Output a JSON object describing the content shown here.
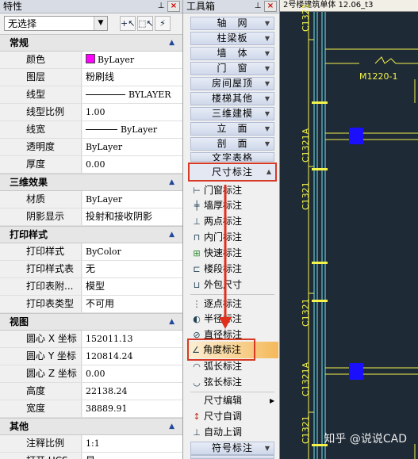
{
  "properties": {
    "title": "特性",
    "selection": "无选择",
    "sections": [
      {
        "title": "常规",
        "rows": [
          {
            "key": "颜色",
            "value": "ByLayer"
          },
          {
            "key": "图层",
            "value": "粉刷线"
          },
          {
            "key": "线型",
            "value": "BYLAYER"
          },
          {
            "key": "线型比例",
            "value": "1.00"
          },
          {
            "key": "线宽",
            "value": "ByLayer"
          },
          {
            "key": "透明度",
            "value": "ByLayer"
          },
          {
            "key": "厚度",
            "value": "0.00"
          }
        ]
      },
      {
        "title": "三维效果",
        "rows": [
          {
            "key": "材质",
            "value": "ByLayer"
          },
          {
            "key": "阴影显示",
            "value": "投射和接收阴影"
          }
        ]
      },
      {
        "title": "打印样式",
        "rows": [
          {
            "key": "打印样式",
            "value": "ByColor"
          },
          {
            "key": "打印样式表",
            "value": "无"
          },
          {
            "key": "打印表附...",
            "value": "模型"
          },
          {
            "key": "打印表类型",
            "value": "不可用"
          }
        ]
      },
      {
        "title": "视图",
        "rows": [
          {
            "key": "圆心 X 坐标",
            "value": "152011.13"
          },
          {
            "key": "圆心 Y 坐标",
            "value": "120814.24"
          },
          {
            "key": "圆心 Z 坐标",
            "value": "0.00"
          },
          {
            "key": "高度",
            "value": "22138.24"
          },
          {
            "key": "宽度",
            "value": "38889.91"
          }
        ]
      },
      {
        "title": "其他",
        "rows": [
          {
            "key": "注释比例",
            "value": "1:1"
          },
          {
            "key": "打开 UCS...",
            "value": "是"
          }
        ]
      }
    ],
    "color_swatch": "#ff00ff"
  },
  "toolbox": {
    "title": "工具箱",
    "menus": [
      "轴　网",
      "柱梁板",
      "墙　体",
      "门　窗",
      "房间屋顶",
      "楼梯其他",
      "三维建模",
      "立　面",
      "剖　面",
      "文字表格"
    ],
    "active_menu": "尺寸标注",
    "items_a": [
      "门窗标注",
      "墙厚标注",
      "两点标注",
      "内门标注",
      "快速标注",
      "楼段标注",
      "外包尺寸"
    ],
    "items_b": [
      "逐点标注",
      "半径标注",
      "直径标注",
      "角度标注",
      "弧长标注",
      "弦长标注"
    ],
    "items_c": [
      "尺寸编辑",
      "尺寸自调",
      "自动上调"
    ],
    "bottom_menu": "符号标注"
  },
  "drawing": {
    "tab_title": "2号楼建筑单体 12.06_t3",
    "labels": [
      "C1321",
      "M1220-1",
      "C1321A",
      "C1321",
      "C1321",
      "C1321A",
      "C1321"
    ],
    "watermark": "知乎 @说说CAD",
    "line_color": "#f5f34a",
    "marker_color": "#1a10ff"
  }
}
